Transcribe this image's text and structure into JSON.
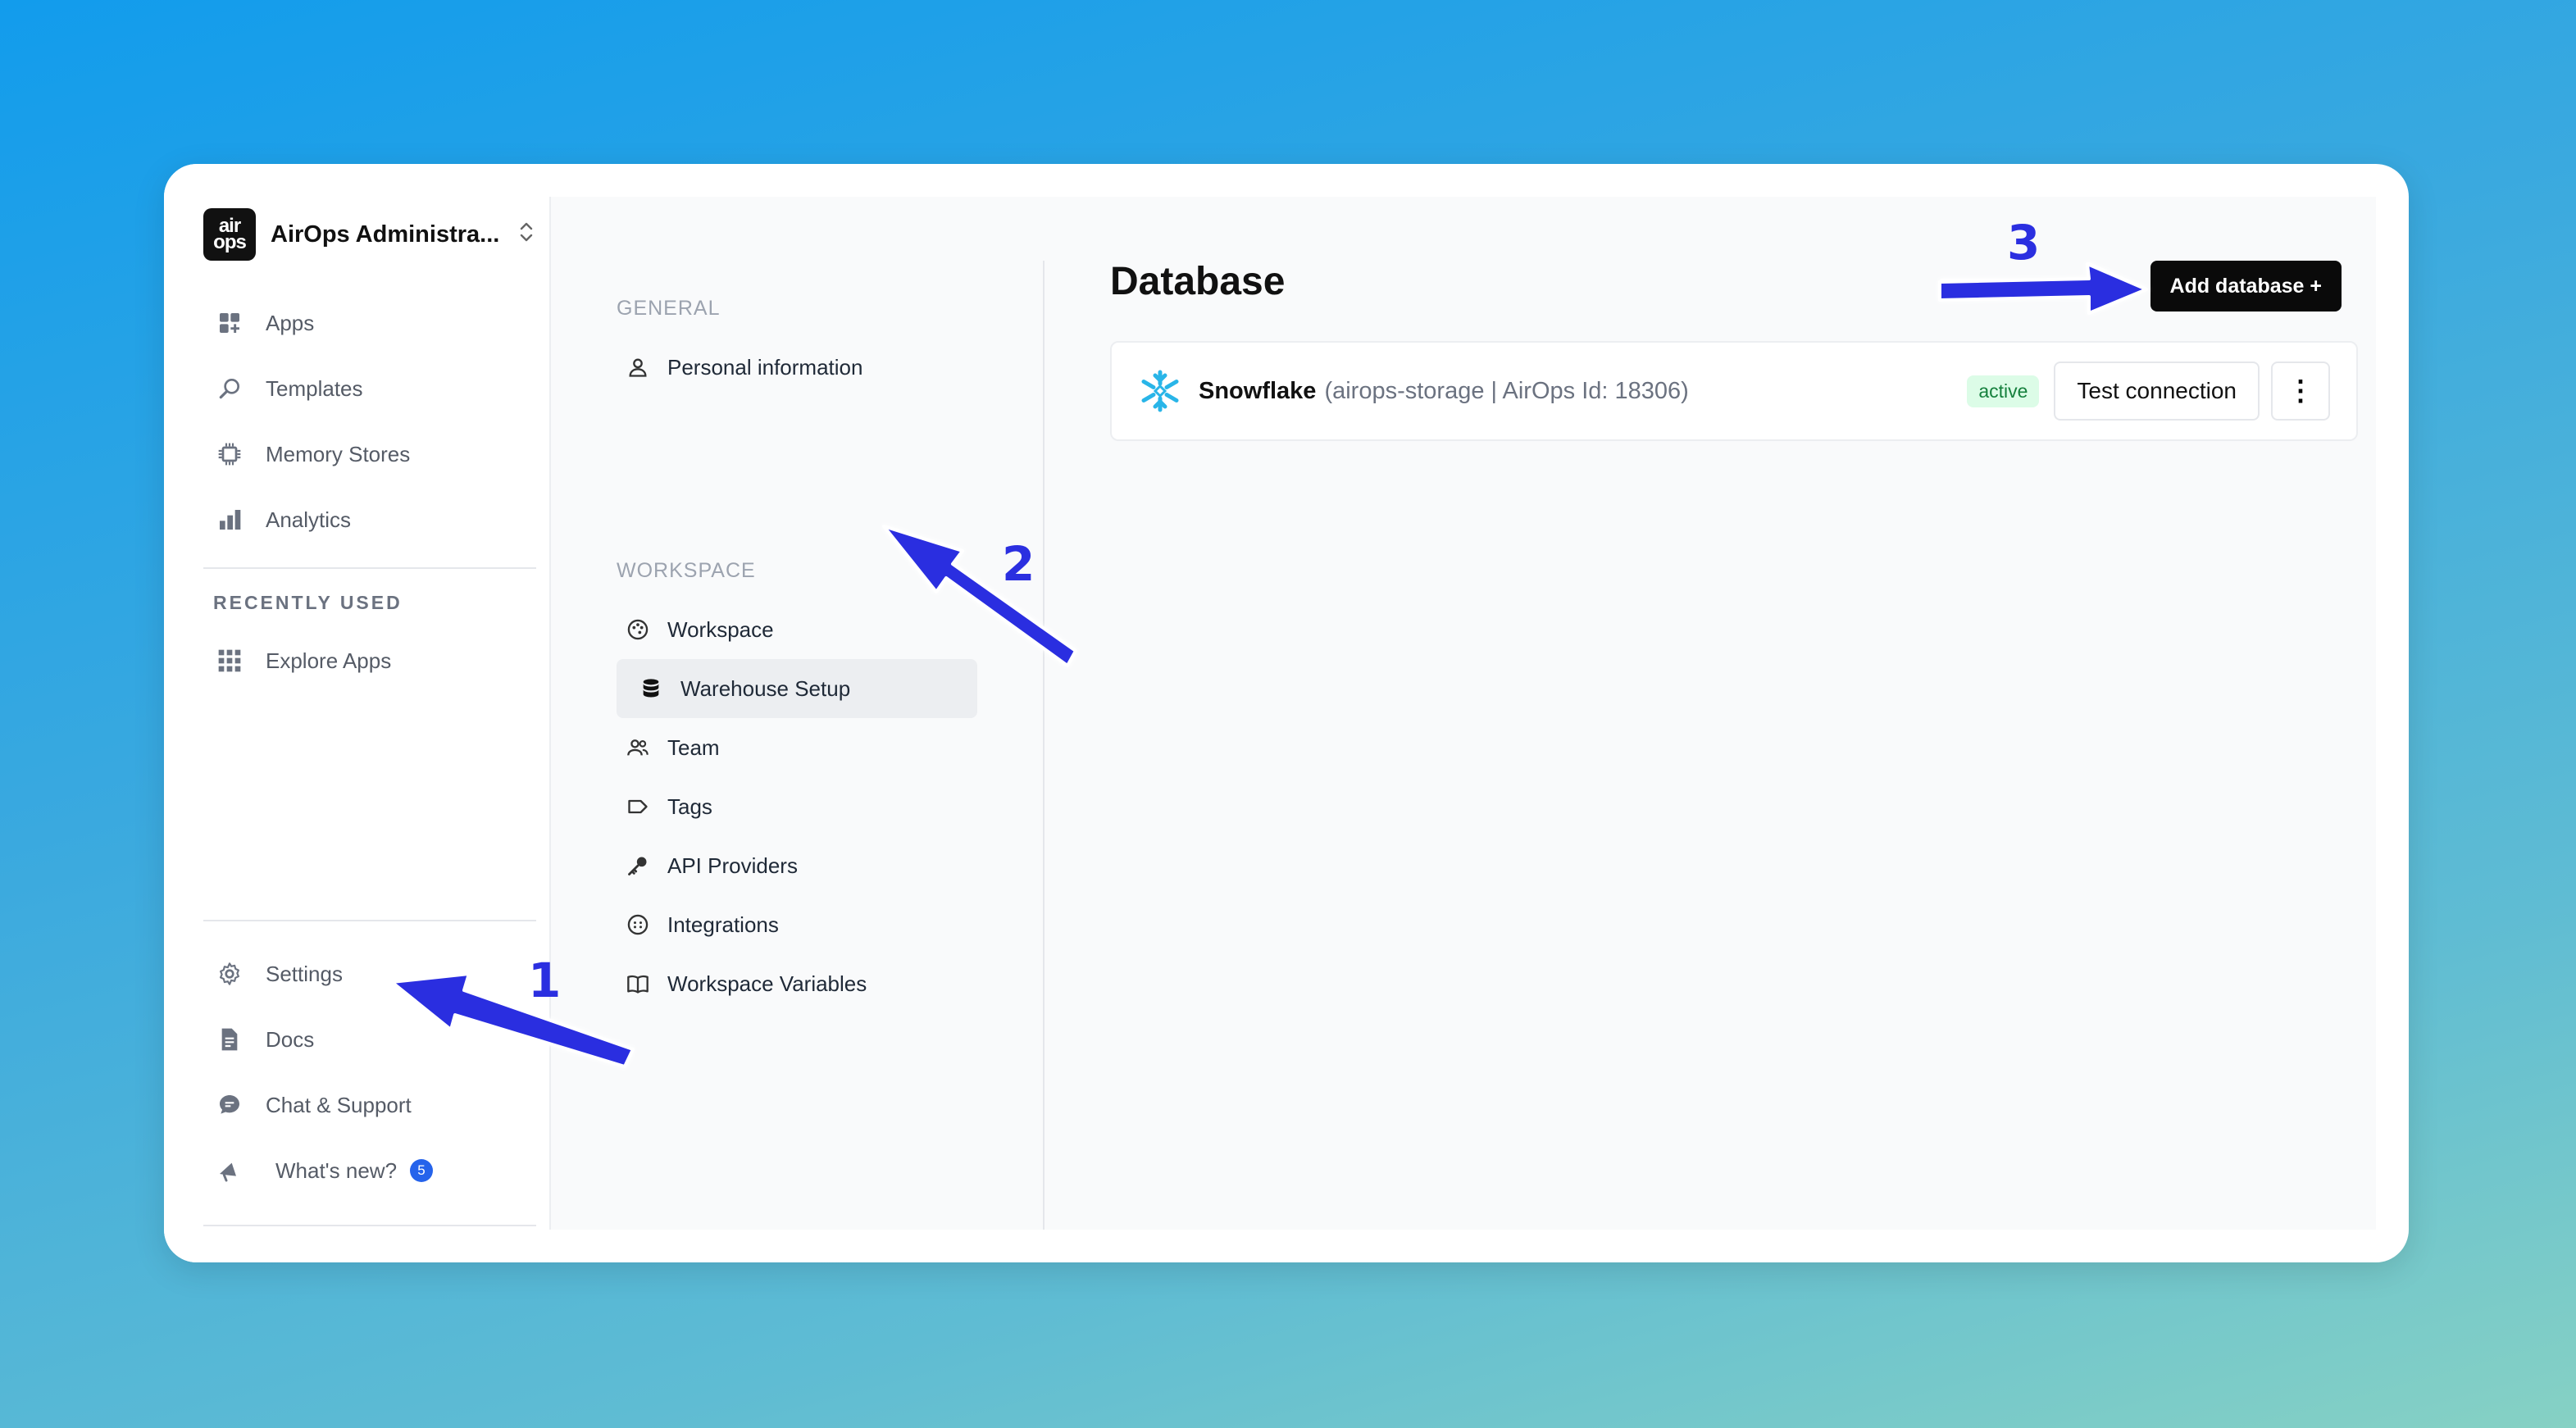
{
  "org": {
    "logo_top": "air",
    "logo_bottom": "ops",
    "name": "AirOps Administra...",
    "chevron": "⌃⌄"
  },
  "sidebar": {
    "items": [
      {
        "label": "Apps",
        "icon": "apps-icon"
      },
      {
        "label": "Templates",
        "icon": "search-icon"
      },
      {
        "label": "Memory Stores",
        "icon": "chip-icon"
      },
      {
        "label": "Analytics",
        "icon": "bar-chart-icon"
      }
    ],
    "recent_label": "RECENTLY USED",
    "recent_items": [
      {
        "label": "Explore Apps",
        "icon": "grid-icon"
      }
    ],
    "bottom_items": [
      {
        "label": "Settings",
        "icon": "gear-icon"
      },
      {
        "label": "Docs",
        "icon": "document-icon"
      },
      {
        "label": "Chat & Support",
        "icon": "chat-icon"
      },
      {
        "label": "What's new?",
        "icon": "megaphone-icon",
        "badge": "5"
      }
    ]
  },
  "settings_nav": {
    "general_label": "GENERAL",
    "general_items": [
      {
        "label": "Personal information",
        "icon": "user-icon"
      }
    ],
    "workspace_label": "WORKSPACE",
    "workspace_items": [
      {
        "label": "Workspace",
        "icon": "palette-icon"
      },
      {
        "label": "Warehouse Setup",
        "icon": "database-icon",
        "active": true
      },
      {
        "label": "Team",
        "icon": "team-icon"
      },
      {
        "label": "Tags",
        "icon": "tag-icon"
      },
      {
        "label": "API Providers",
        "icon": "key-icon"
      },
      {
        "label": "Integrations",
        "icon": "integrations-icon"
      },
      {
        "label": "Workspace Variables",
        "icon": "book-icon"
      }
    ]
  },
  "main": {
    "title": "Database",
    "add_button": "Add database +",
    "database": {
      "name": "Snowflake",
      "detail": "(airops-storage | AirOps Id: 18306)",
      "status": "active",
      "test_button": "Test connection",
      "more_label": "⋮"
    }
  },
  "annotations": {
    "step1": "1",
    "step2": "2",
    "step3": "3"
  },
  "colors": {
    "arrow": "#2b2fe0",
    "snowflake": "#29b5e8",
    "active_bg": "#dcfce7",
    "active_text": "#15803d"
  }
}
